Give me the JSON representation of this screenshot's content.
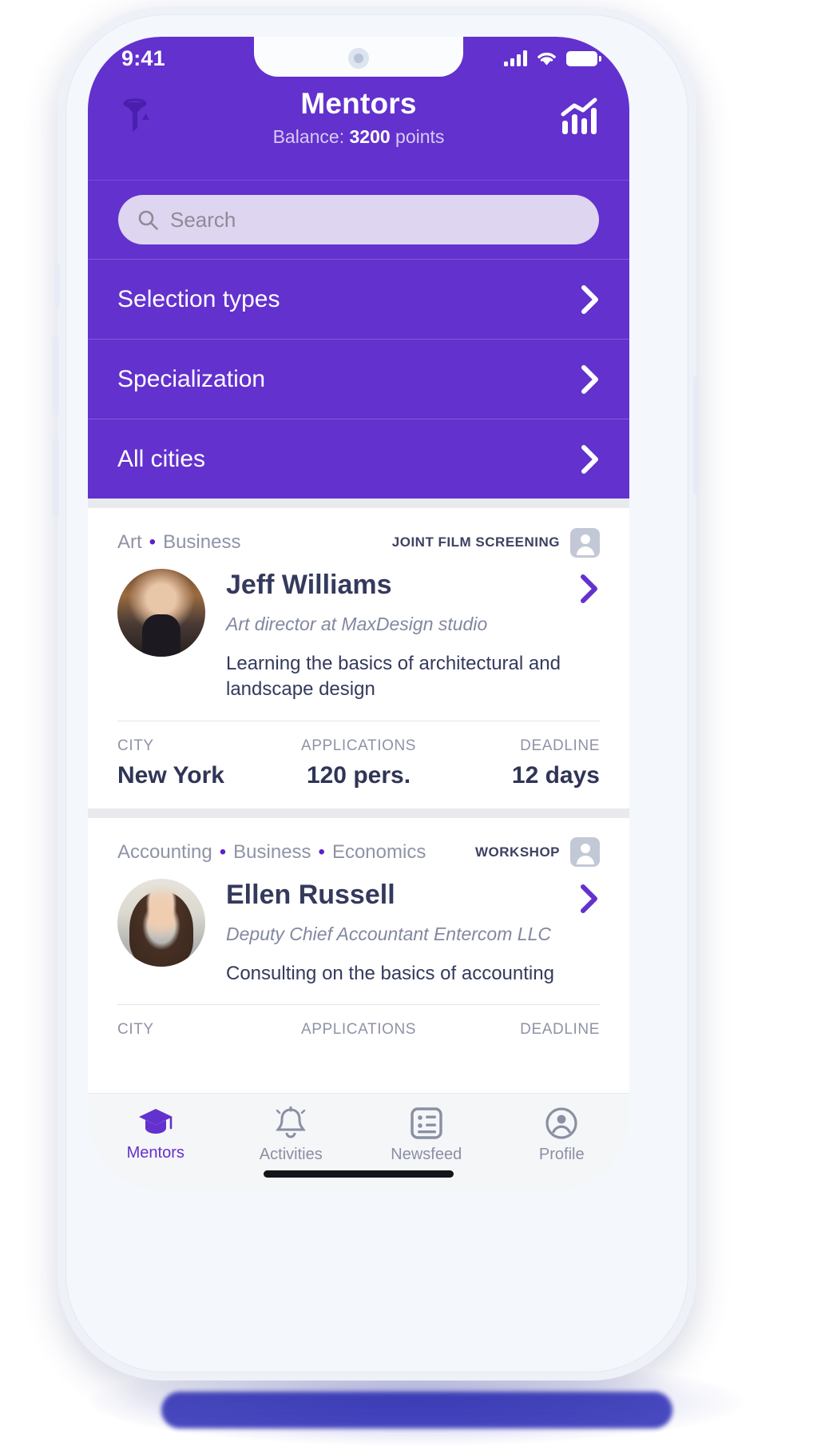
{
  "status_bar": {
    "time": "9:41",
    "icons": [
      "signal-icon",
      "wifi-icon",
      "battery-icon"
    ]
  },
  "header": {
    "filter_icon": "filter-icon",
    "title": "Mentors",
    "balance_prefix": "Balance: ",
    "balance_value": "3200",
    "balance_suffix": " points",
    "stats_icon": "chart-icon",
    "background_color": "#6331CE"
  },
  "search": {
    "placeholder": "Search",
    "value": "",
    "icon": "search-icon",
    "field_color": "#DED5F0"
  },
  "filters": [
    {
      "label": "Selection types",
      "chevron": "chevron-right-icon"
    },
    {
      "label": "Specialization",
      "chevron": "chevron-right-icon"
    },
    {
      "label": "All cities",
      "chevron": "chevron-right-icon"
    }
  ],
  "cards": [
    {
      "tags": [
        "Art",
        "Business"
      ],
      "badge": "JOINT FILM SCREENING",
      "badge_icon": "person-square-icon",
      "name": "Jeff Williams",
      "role": "Art director at MaxDesign studio",
      "description": "Learning the basics of architectural and landscape design",
      "chevron": "chevron-right-icon",
      "stats": [
        {
          "label": "CITY",
          "value": "New York"
        },
        {
          "label": "APPLICATIONS",
          "value": "120 pers."
        },
        {
          "label": "DEADLINE",
          "value": "12 days"
        }
      ]
    },
    {
      "tags": [
        "Accounting",
        "Business",
        "Economics"
      ],
      "badge": "WORKSHOP",
      "badge_icon": "person-square-icon",
      "name": "Ellen Russell",
      "role": "Deputy Chief Accountant Entercom LLC",
      "description": "Consulting on the basics of accounting",
      "chevron": "chevron-right-icon",
      "stats": [
        {
          "label": "CITY",
          "value": ""
        },
        {
          "label": "APPLICATIONS",
          "value": ""
        },
        {
          "label": "DEADLINE",
          "value": ""
        }
      ]
    }
  ],
  "tabbar": {
    "items": [
      {
        "label": "Mentors",
        "icon": "graduation-cap-icon",
        "active": true
      },
      {
        "label": "Activities",
        "icon": "bell-icon",
        "active": false
      },
      {
        "label": "Newsfeed",
        "icon": "list-icon",
        "active": false
      },
      {
        "label": "Profile",
        "icon": "user-circle-icon",
        "active": false
      }
    ],
    "active_color": "#6331CE",
    "inactive_color": "#8A8FA3"
  }
}
